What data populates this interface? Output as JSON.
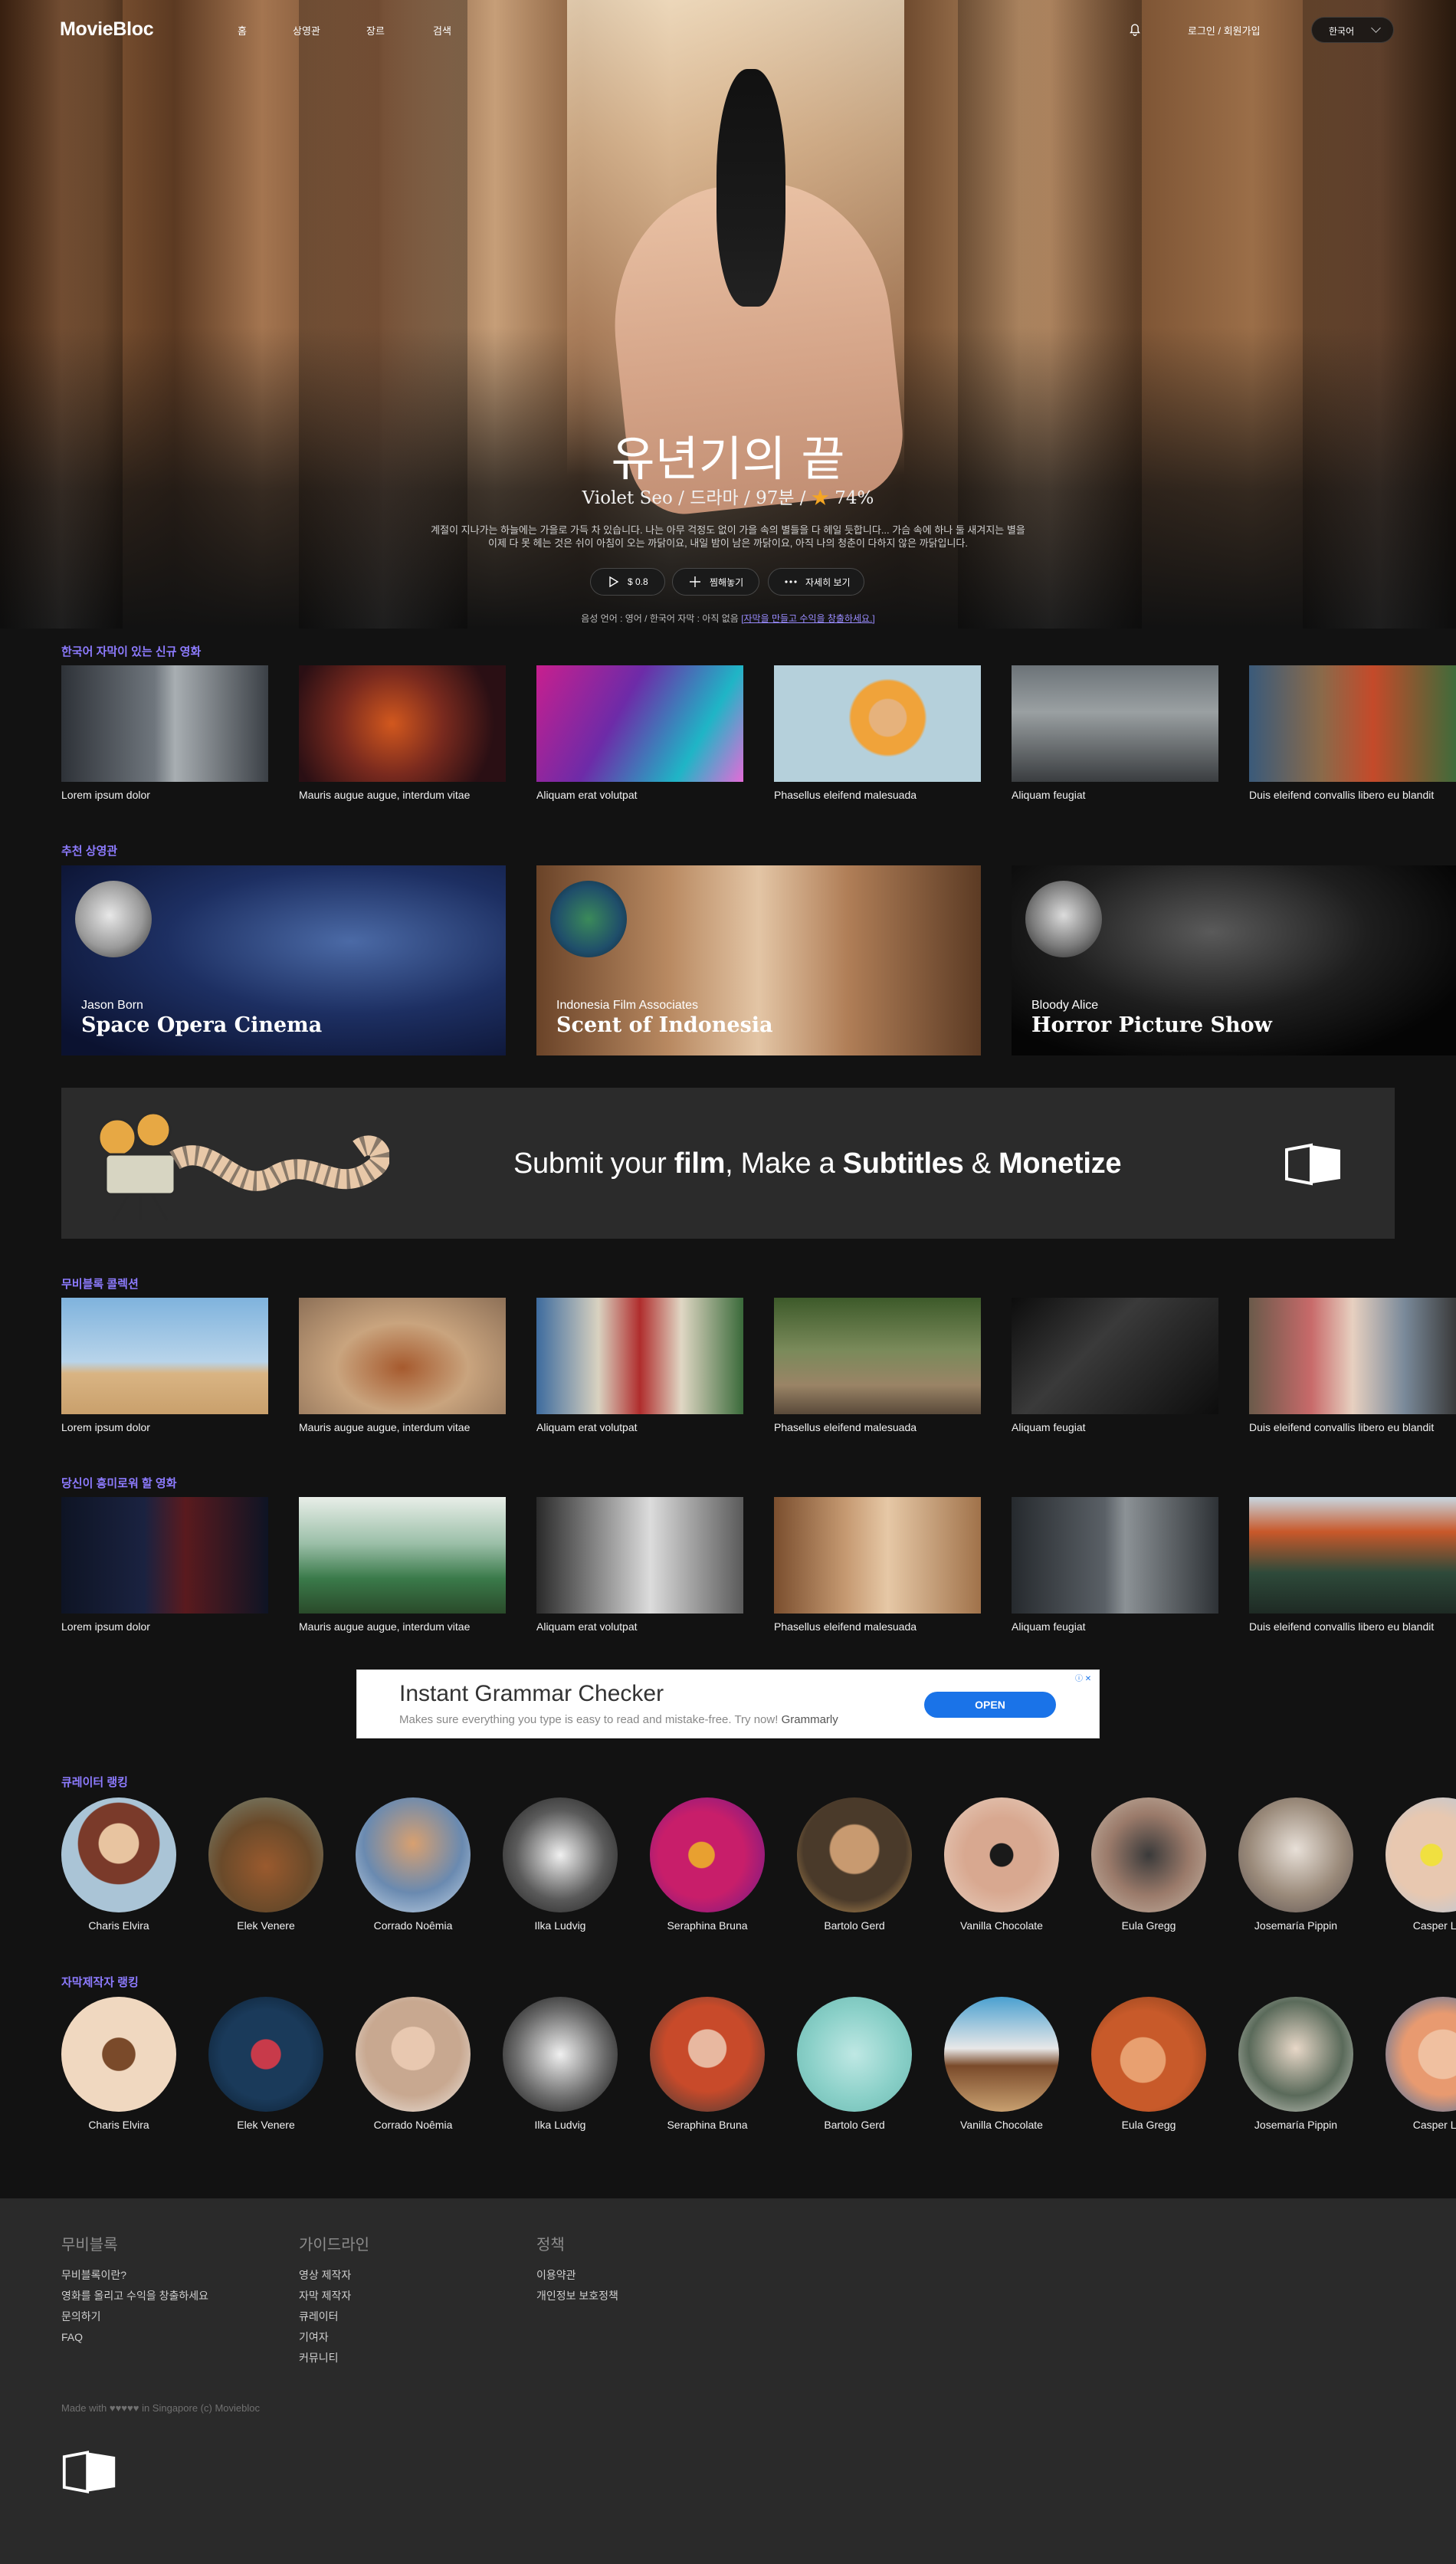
{
  "nav": {
    "logo": "MovieBloc",
    "links": [
      "홈",
      "상영관",
      "장르",
      "검색"
    ],
    "login": "로그인 / 회원가입",
    "language": "한국어"
  },
  "hero": {
    "title": "유년기의 끝",
    "meta_director": "Violet Seo",
    "meta_genre": "드라마",
    "meta_runtime": "97분",
    "meta_rating": "74%",
    "desc_line1": "계절이 지나가는 하늘에는 가을로 가득 차 있습니다. 나는 아무 걱정도 없이 가을 속의 별들을 다 헤일 듯합니다... 가슴 속에 하나 둘 새겨지는 별을",
    "desc_line2": "이제 다 못 헤는 것은 쉬이 아침이 오는 까닭이요, 내일 밤이 남은 까닭이요, 아직 나의 청춘이 다하지 않은 까닭입니다.",
    "btn_price": "$ 0.8",
    "btn_wishlist": "찜해놓기",
    "btn_more": "자세히 보기",
    "note_text": "음성 언어 : 영어 / 한국어 자막 : 아직 없음",
    "note_link": "[자막을 만들고 수익을 창출하세요.]"
  },
  "sections": {
    "new_subtitled": {
      "title": "한국어 자막이 있는 신규 영화",
      "items": [
        "Lorem ipsum dolor",
        "Mauris augue augue, interdum vitae",
        "Aliquam erat volutpat",
        "Phasellus eleifend malesuada",
        "Aliquam feugiat",
        "Duis eleifend convallis libero eu blandit"
      ]
    },
    "theaters": {
      "title": "추천 상영관",
      "items": [
        {
          "sub": "Jason Born",
          "name": "Space Opera Cinema"
        },
        {
          "sub": "Indonesia Film Associates",
          "name": "Scent of Indonesia"
        },
        {
          "sub": "Bloody Alice",
          "name": "Horror Picture Show"
        }
      ]
    },
    "banner": {
      "pre": "Submit your ",
      "b1": "film",
      "mid": ", Make a ",
      "b2": "Subtitles",
      "amp": " & ",
      "b3": "Monetize"
    },
    "collection": {
      "title": "무비블록 콜렉션",
      "items": [
        "Lorem ipsum dolor",
        "Mauris augue augue, interdum vitae",
        "Aliquam erat volutpat",
        "Phasellus eleifend malesuada",
        "Aliquam feugiat",
        "Duis eleifend convallis libero eu blandit"
      ]
    },
    "interest": {
      "title": "당신이 흥미로워 할 영화",
      "items": [
        "Lorem ipsum dolor",
        "Mauris augue augue, interdum vitae",
        "Aliquam erat volutpat",
        "Phasellus eleifend malesuada",
        "Aliquam feugiat",
        "Duis eleifend convallis libero eu blandit"
      ]
    },
    "ad": {
      "title": "Instant Grammar Checker",
      "desc": "Makes sure everything you type is easy to read and mistake-free. Try now!",
      "brand": "Grammarly",
      "open": "OPEN"
    },
    "curators": {
      "title": "큐레이터 랭킹",
      "people": [
        "Charis Elvira",
        "Elek Venere",
        "Corrado Noêmia",
        "Ilka Ludvig",
        "Seraphina Bruna",
        "Bartolo Gerd",
        "Vanilla Chocolate",
        "Eula Gregg",
        "Josemaría Pippin",
        "Casper Laks"
      ]
    },
    "subtitlers": {
      "title": "자막제작자 랭킹",
      "people": [
        "Charis Elvira",
        "Elek Venere",
        "Corrado Noêmia",
        "Ilka Ludvig",
        "Seraphina Bruna",
        "Bartolo Gerd",
        "Vanilla Chocolate",
        "Eula Gregg",
        "Josemaría Pippin",
        "Casper Laks"
      ]
    }
  },
  "footer": {
    "col1": {
      "heading": "무비블록",
      "links": [
        "무비블록이란?",
        "영화를 올리고 수익을 창출하세요",
        "문의하기",
        "FAQ"
      ]
    },
    "col2": {
      "heading": "가이드라인",
      "links": [
        "영상 제작자",
        "자막 제작자",
        "큐레이터",
        "기여자",
        "커뮤니티"
      ]
    },
    "col3": {
      "heading": "정책",
      "links": [
        "이용약관",
        "개인정보 보호정책"
      ]
    },
    "made": "Made with ♥♥♥♥♥ in Singapore (c) Moviebloc"
  }
}
